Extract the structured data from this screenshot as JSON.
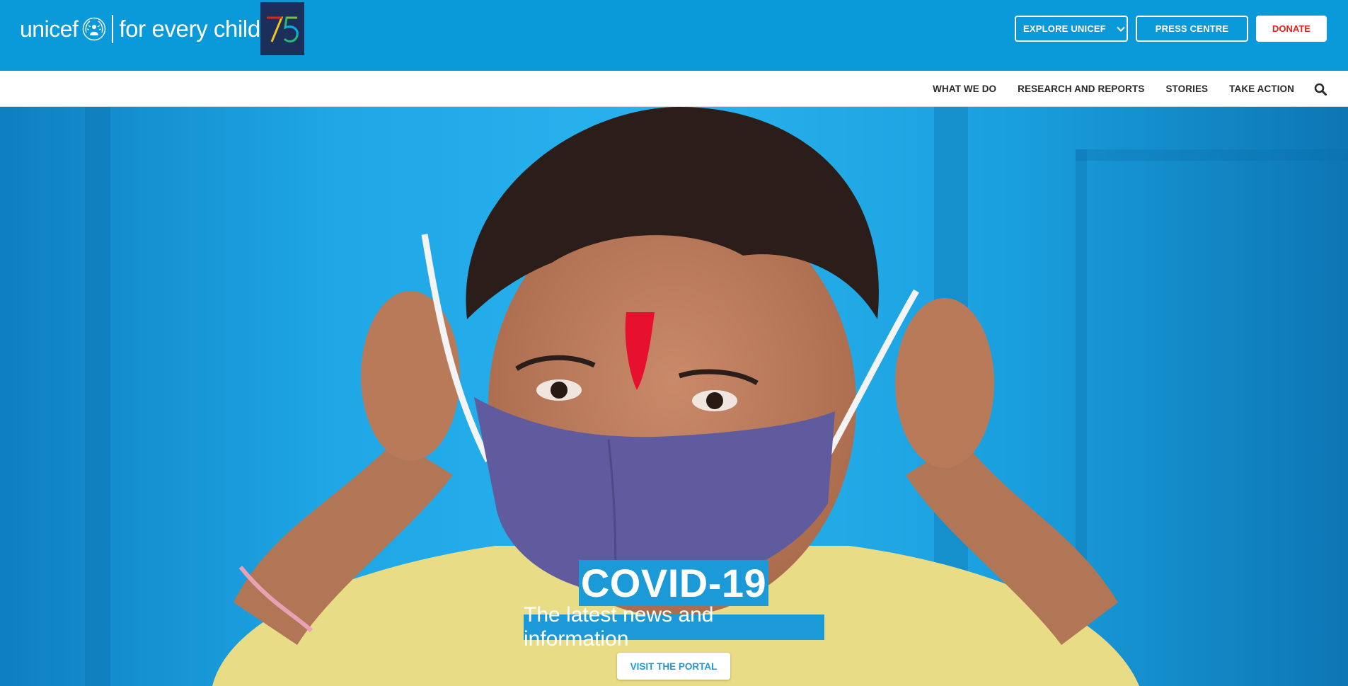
{
  "header": {
    "logo_word": "unicef",
    "tagline": "for every child",
    "anniversary_badge": "75",
    "explore_label": "EXPLORE UNICEF",
    "press_label": "PRESS CENTRE",
    "donate_label": "DONATE"
  },
  "nav": {
    "items": [
      {
        "label": "WHAT WE DO"
      },
      {
        "label": "RESEARCH AND REPORTS"
      },
      {
        "label": "STORIES"
      },
      {
        "label": "TAKE ACTION"
      }
    ],
    "search_icon": "search-icon"
  },
  "hero": {
    "title": "COVID-19",
    "subtitle": "The latest news and information",
    "cta_label": "VISIT THE PORTAL"
  },
  "colors": {
    "brand_blue": "#1c9ad8",
    "topbar_blue": "#0a99d9",
    "donate_red": "#e2231a",
    "badge_navy": "#1c2f5a"
  }
}
